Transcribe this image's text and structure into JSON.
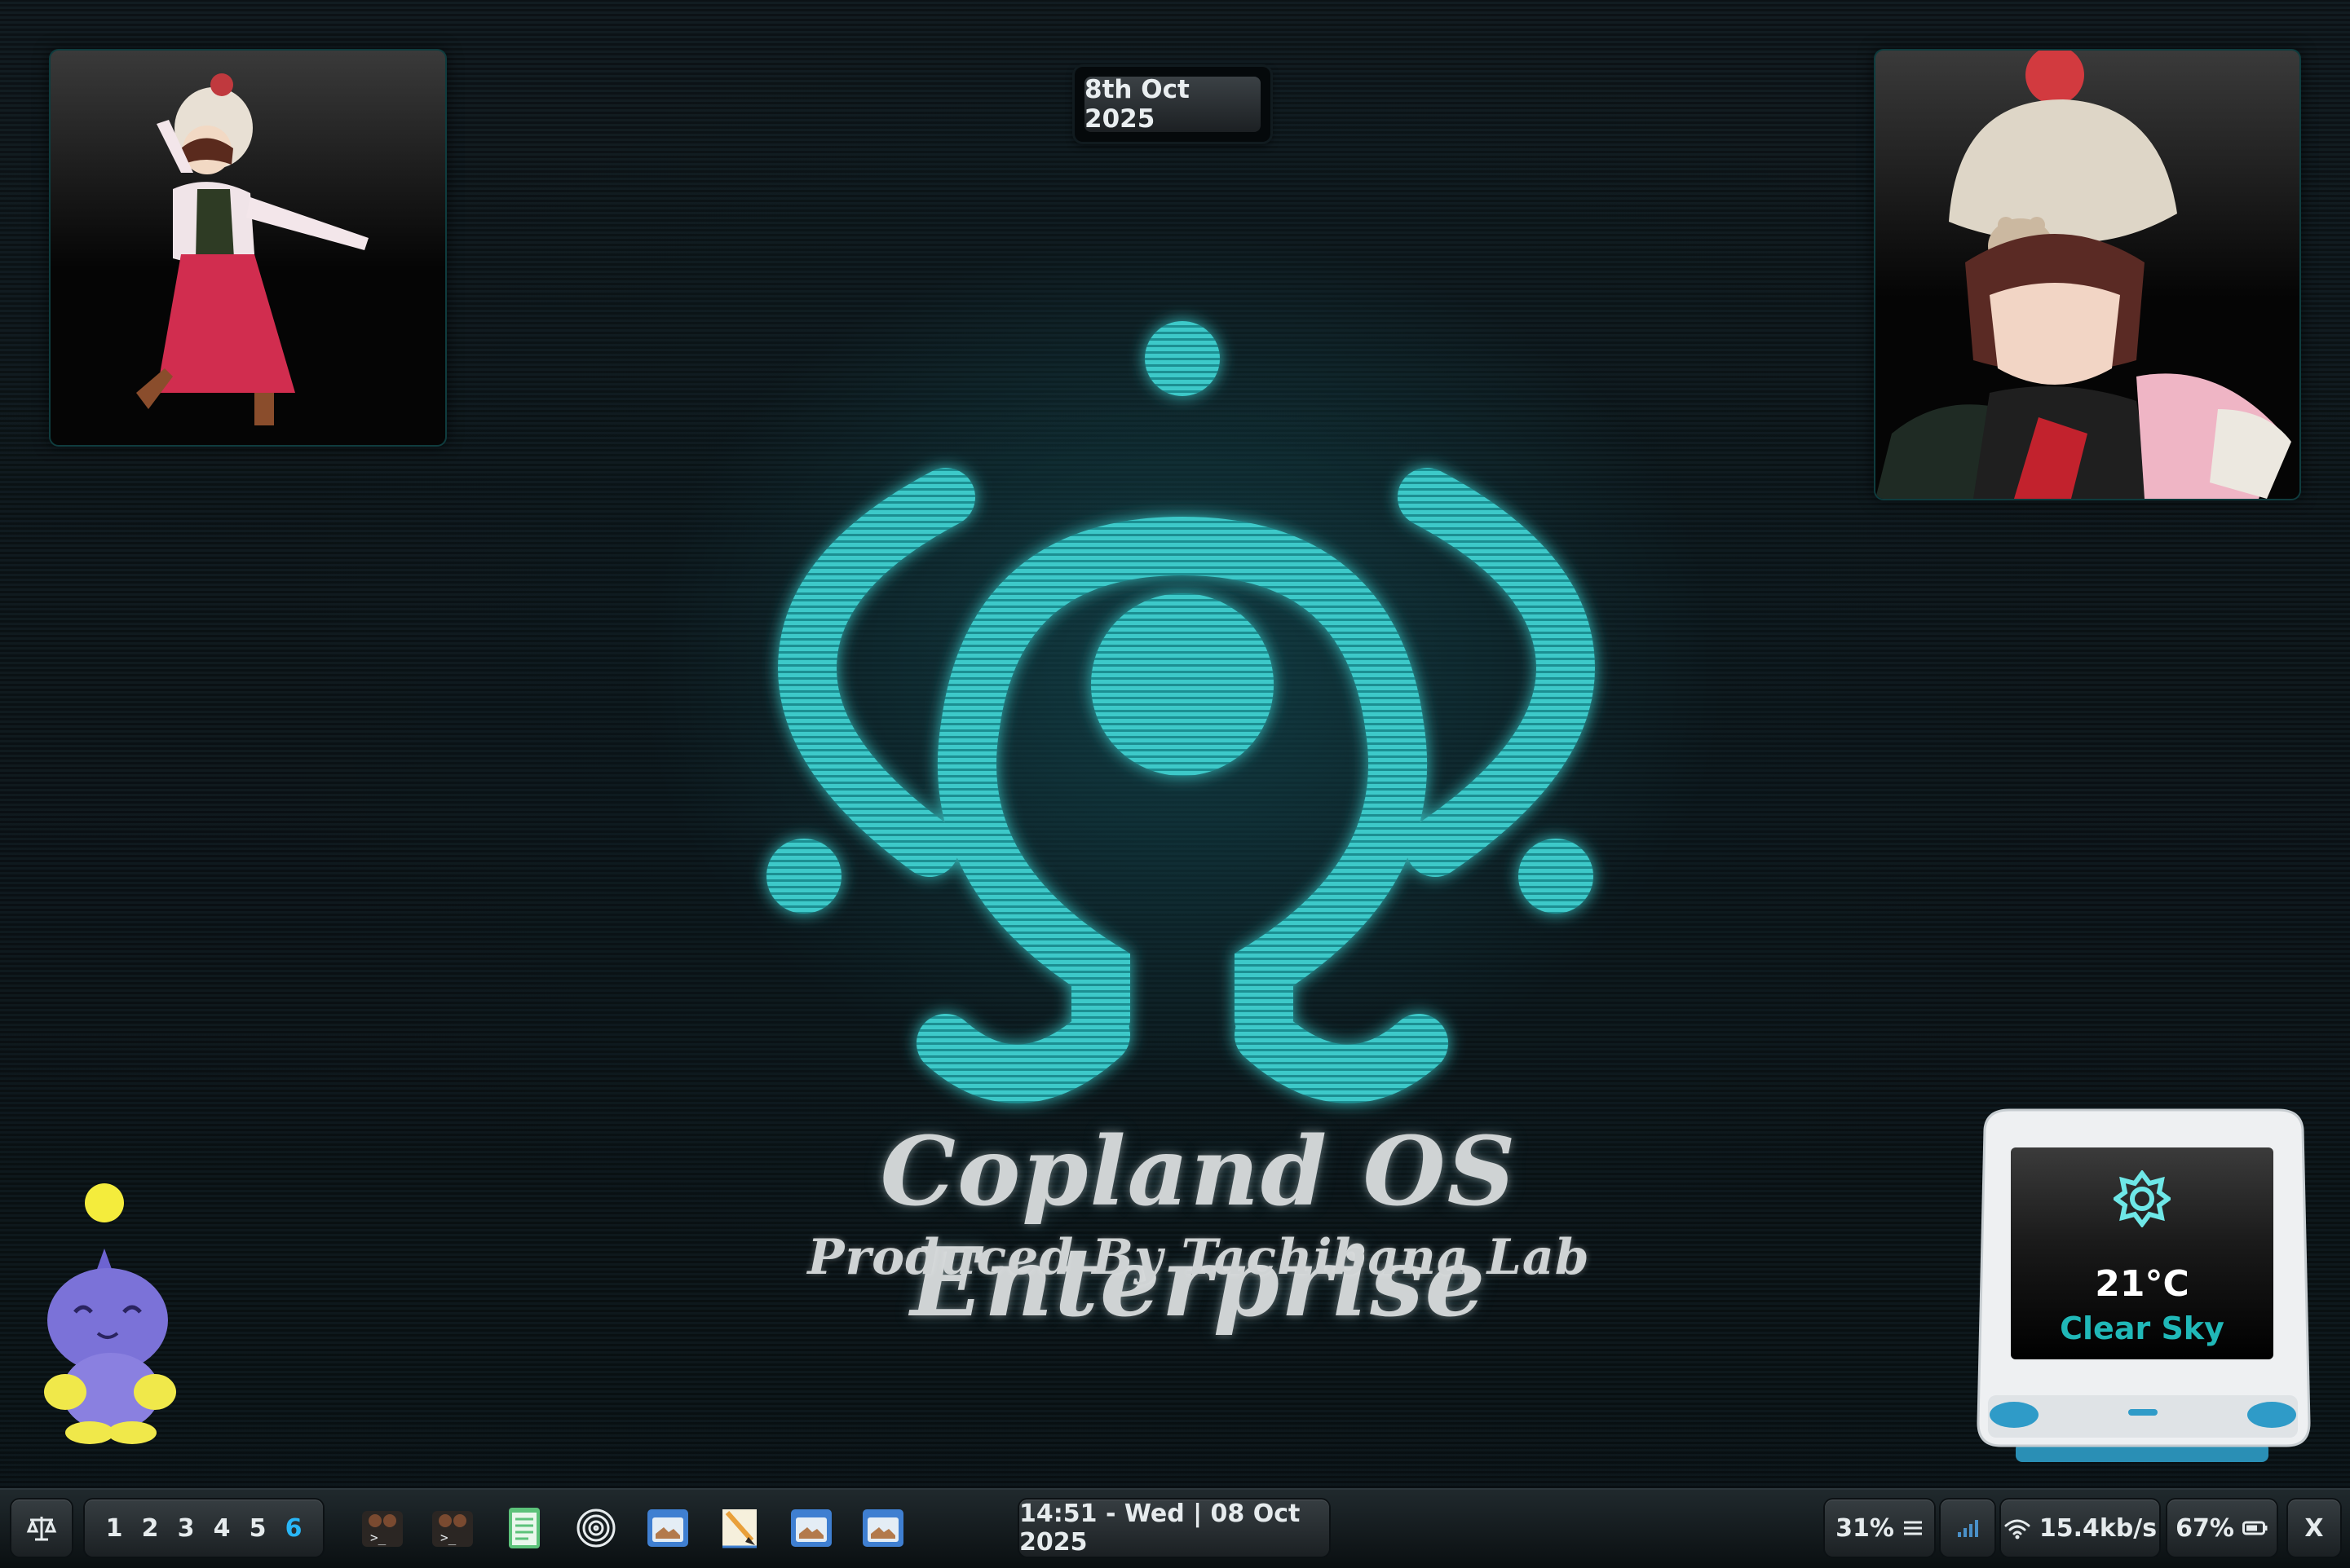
{
  "desktop": {
    "date_badge": "8th Oct 2025",
    "brand": {
      "title": "Copland OS Enterprise",
      "subtitle": "Produced By Tachibana Lab"
    },
    "colors": {
      "accent": "#3cc9c9",
      "logo": "#34b3b5",
      "active_workspace": "#29b6f6"
    }
  },
  "weather": {
    "icon": "sun-icon",
    "temperature": "21°C",
    "condition": "Clear Sky"
  },
  "taskbar": {
    "launcher_icon": "scales-icon",
    "workspaces": [
      {
        "label": "1",
        "active": false
      },
      {
        "label": "2",
        "active": false
      },
      {
        "label": "3",
        "active": false
      },
      {
        "label": "4",
        "active": false
      },
      {
        "label": "5",
        "active": false
      },
      {
        "label": "6",
        "active": true
      }
    ],
    "apps": [
      {
        "name": "terminal-1-icon"
      },
      {
        "name": "terminal-2-icon"
      },
      {
        "name": "text-editor-icon"
      },
      {
        "name": "spiral-app-icon"
      },
      {
        "name": "file-manager-1-icon"
      },
      {
        "name": "notes-icon"
      },
      {
        "name": "file-manager-2-icon"
      },
      {
        "name": "file-manager-3-icon"
      }
    ],
    "clock": "14:51 - Wed | 08 Oct 2025",
    "volume": "31%",
    "network_speed": "15.4kb/s",
    "battery": "67%",
    "close_label": "X"
  }
}
